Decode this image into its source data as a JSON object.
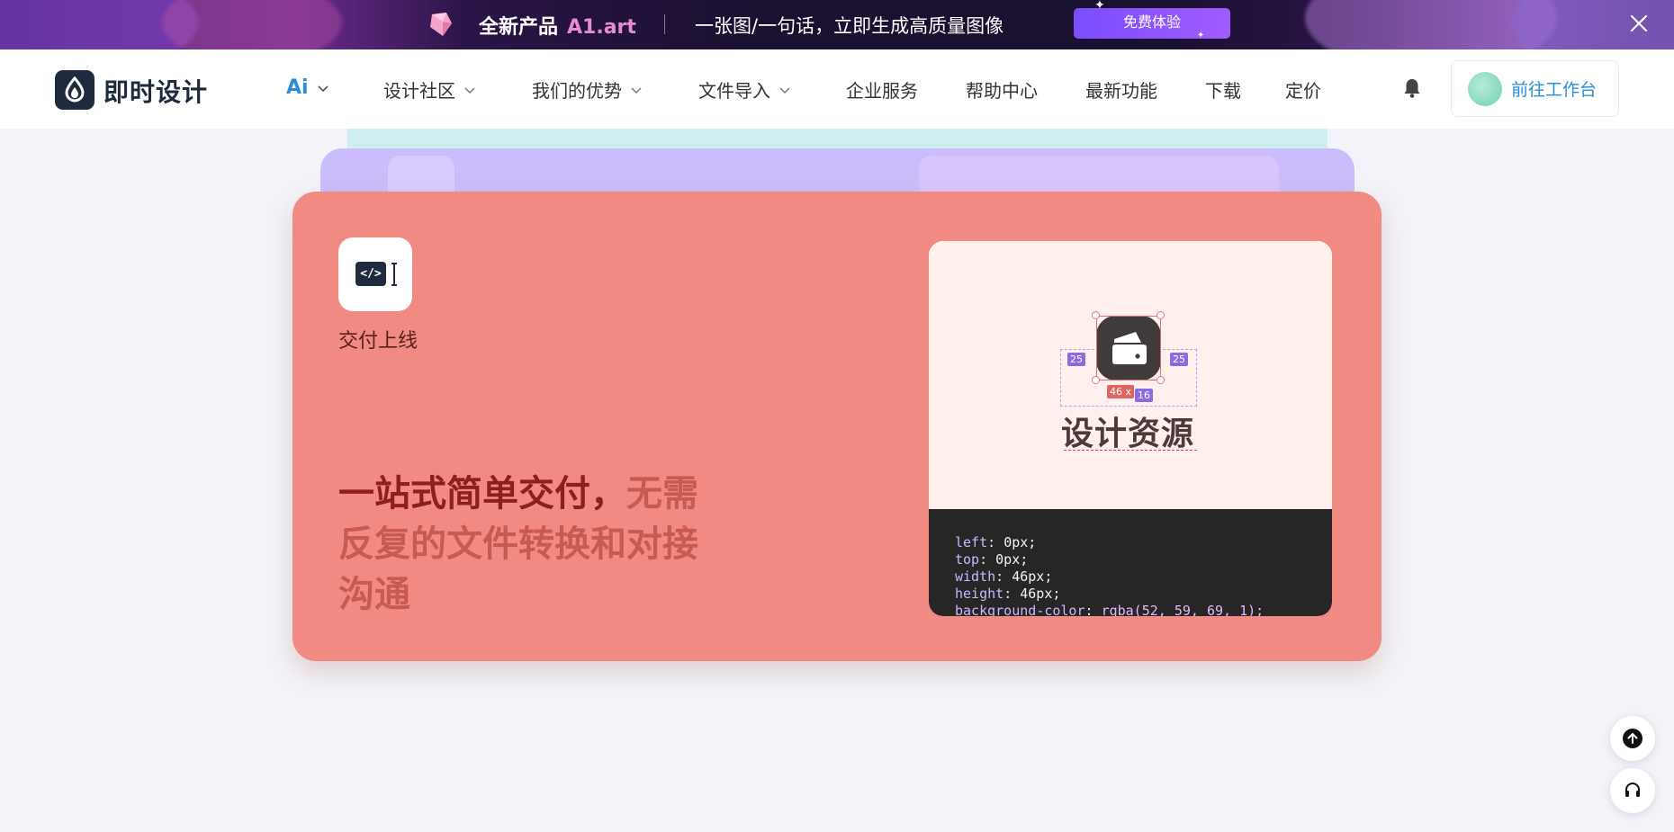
{
  "promo": {
    "brand": "全新产品",
    "product": "A1.art",
    "slogan": "一张图/一句话，立即生成高质量图像",
    "cta": "免费体验"
  },
  "nav": {
    "logo_text": "即时设计",
    "items": [
      {
        "label": "Ai",
        "dropdown": true
      },
      {
        "label": "设计社区",
        "dropdown": true
      },
      {
        "label": "我们的优势",
        "dropdown": true
      },
      {
        "label": "文件导入",
        "dropdown": true
      },
      {
        "label": "企业服务",
        "dropdown": false
      },
      {
        "label": "帮助中心",
        "dropdown": false
      },
      {
        "label": "最新功能",
        "dropdown": false
      },
      {
        "label": "下载",
        "dropdown": false
      },
      {
        "label": "定价",
        "dropdown": false
      }
    ],
    "workbench_label": "前往工作台"
  },
  "feature_card": {
    "label": "交付上线",
    "icon_code": "</>",
    "headline_strong": "一站式简单交付，",
    "headline_rest": "无需反复的文件转换和对接沟通",
    "preview": {
      "title": "设计资源",
      "measure_left": "25",
      "measure_right": "25",
      "measure_size": "46 x",
      "measure_bottom": "16",
      "code_lines": [
        {
          "k": "left",
          "v": "0px;"
        },
        {
          "k": "top",
          "v": "0px;"
        },
        {
          "k": "width",
          "v": "46px;"
        },
        {
          "k": "height",
          "v": "46px;"
        },
        {
          "k": "background-color",
          "v": "rgba(52, 59, 69, 1);"
        }
      ]
    }
  },
  "colors": {
    "card_bg": "#f08a82",
    "accent_blue": "#2a8ddb",
    "headline_dark": "#8e1f1c",
    "headline_light": "#c85a52"
  },
  "icons": [
    "gem-icon",
    "close-icon",
    "chevron-down-icon",
    "bell-icon",
    "code-icon",
    "text-cursor-icon",
    "folder-icon",
    "arrow-up-icon",
    "headset-icon"
  ]
}
